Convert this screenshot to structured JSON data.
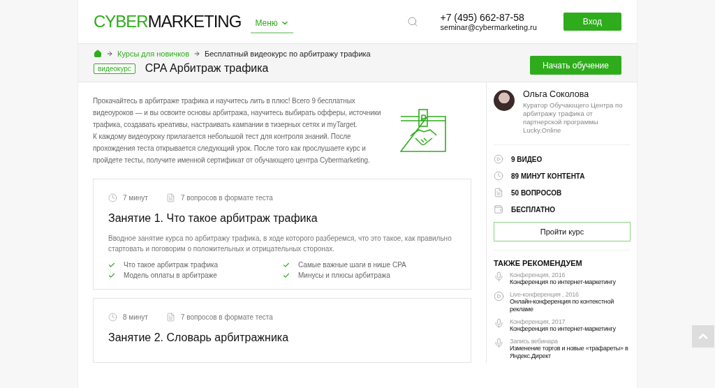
{
  "header": {
    "logo": {
      "accent": "CYBER",
      "rest": "MARKETING"
    },
    "menu": "Меню",
    "phone": "+7 (495) 662-87-58",
    "email": "seminar@cybermarketing.ru",
    "login": "Вход"
  },
  "breadcrumbs": [
    "Курсы для новичков",
    "Бесплатный видеокурс по арбитражу трафика"
  ],
  "course": {
    "tag": "видеокурс",
    "title": "CPA Арбитраж трафика",
    "start": "Начать обучение"
  },
  "intro": [
    "Прокачайтесь в арбитраже трафика и научитесь лить в плюс! Всего 9 бесплатных видеоуроков — и вы освоите основы арбитража, научитесь выбирать офферы, источники трафика, создавать креативы, настраивать кампании в тизерных сетях и myTarget.",
    "К каждому видеоуроку прилагается небольшой тест для контроля знаний. После прохождения теста открывается следующий урок. После того как прослушаете курс и пройдете тесты, получите именной сертификат от обучающего центра Cybermarketing."
  ],
  "lessons": [
    {
      "duration": "7 минут",
      "questions": "7 вопросов в формате теста",
      "title": "Занятие 1. Что такое арбитраж трафика",
      "description": "Вводное занятие курса по арбитражу трафика, в ходе которого разберемся, что это такое, как правильно стартовать и поговорим о положительных и отрицательных сторонах.",
      "topics": [
        "Что такое арбитраж трафика",
        "Самые важные шаги в нише CPA",
        "Модель оплаты в арбитраже",
        "Минусы и плюсы арбитража"
      ]
    },
    {
      "duration": "8 минут",
      "questions": "7 вопросов в формате теста",
      "title": "Занятие 2. Словарь арбитражника"
    }
  ],
  "sidebar": {
    "author": {
      "name": "Ольга Соколова",
      "role": "Куратор Обучающего Центра по арбитражу трафика от партнерской программы Lucky.Online"
    },
    "stats": [
      {
        "kind": "video",
        "label": "9 ВИДЕО"
      },
      {
        "kind": "time",
        "label": "89 МИНУТ КОНТЕНТА"
      },
      {
        "kind": "questions",
        "label": "50 ВОПРОСОВ"
      },
      {
        "kind": "price",
        "label": "БЕСПЛАТНО"
      }
    ],
    "action": "Пройти курс",
    "recommend_title": "ТАКЖЕ РЕКОМЕНДУЕМ",
    "recommend": [
      {
        "kind": "audio",
        "meta": "Конференция, 2016",
        "title": "Конференция по интернет-маркетингу"
      },
      {
        "kind": "video",
        "meta": "Live-конференция , 2016",
        "title": "Онлайн-конференция по контекстной рекламе"
      },
      {
        "kind": "audio",
        "meta": "Конференция, 2017",
        "title": "Конференция по интернет-маркетингу"
      },
      {
        "kind": "audio",
        "meta": "Запись вебинара",
        "title": "Изменение торгов и новые «трафареты» в Яндекс.Директ"
      }
    ]
  }
}
